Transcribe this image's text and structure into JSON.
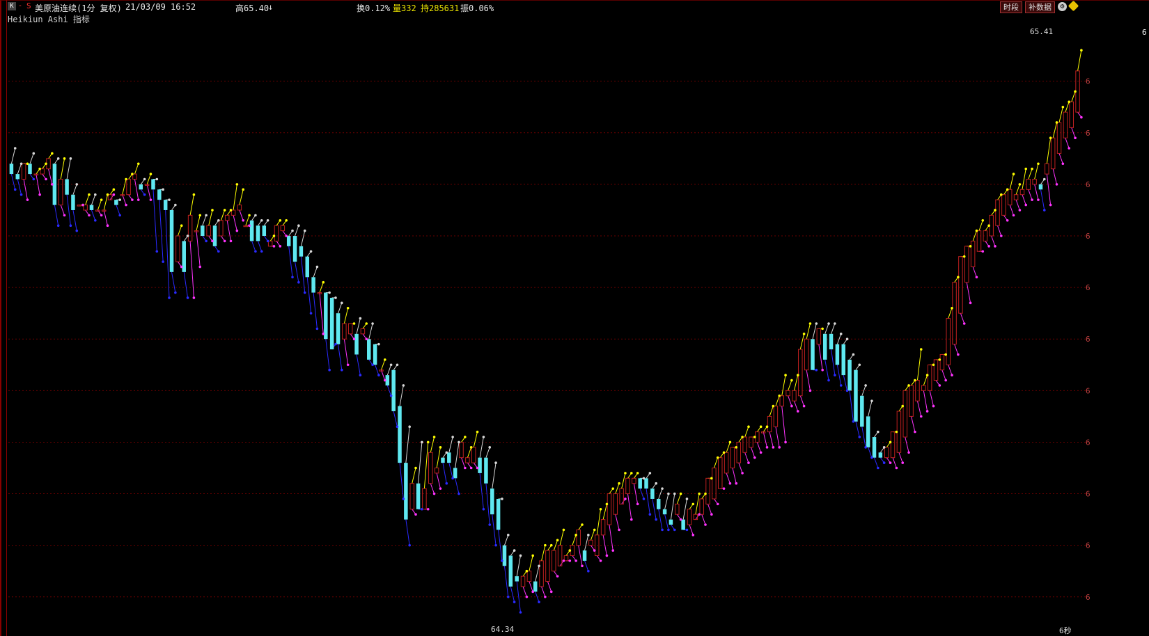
{
  "header": {
    "k_button": "K",
    "s_button": "S",
    "instrument": "美原油连续(1分  复权)",
    "datetime": "21/03/09 16:52",
    "high": "高65.40",
    "high_arrow": "↓",
    "turnover": "换0.12%",
    "volume_label": "量332",
    "hold_label": "持285631",
    "amplitude": "振0.06%",
    "btn_period": "时段",
    "btn_supplement": "补数据",
    "settings_icon": "gear-icon",
    "warn_icon": "diamond-warning-icon"
  },
  "indicator": {
    "name": "Heikiun Ashi 指标"
  },
  "annotations": {
    "max_label": "65.41",
    "min_label": "64.34",
    "timer_label": "6秒",
    "right_tag": "6"
  },
  "colors": {
    "bg": "#000000",
    "up_border": "#c02020",
    "down_fill": "#5fe8f0",
    "grid": "#6a0000",
    "yellow": "#ffff00",
    "magenta": "#ff33ff",
    "blue": "#2a2aff",
    "white": "#d8d8d8"
  },
  "chart_data": {
    "type": "candlestick",
    "ylim": [
      64.32,
      65.44
    ],
    "grid_values": [
      65.35,
      65.25,
      65.15,
      65.05,
      64.95,
      64.85,
      64.75,
      64.65,
      64.55,
      64.45,
      64.35
    ],
    "y_tick_labels": [
      "6",
      "6",
      "6",
      "6",
      "6",
      "6",
      "6",
      "6",
      "6",
      "6",
      "6"
    ],
    "candles": [
      [
        65.19,
        65.17,
        65.22,
        65.14
      ],
      [
        65.17,
        65.16,
        65.19,
        65.13
      ],
      [
        65.16,
        65.19,
        65.19,
        65.12
      ],
      [
        65.19,
        65.17,
        65.21,
        65.16
      ],
      [
        65.17,
        65.17,
        65.18,
        65.13
      ],
      [
        65.17,
        65.18,
        65.19,
        65.16
      ],
      [
        65.18,
        65.2,
        65.21,
        65.15
      ],
      [
        65.19,
        65.11,
        65.2,
        65.07
      ],
      [
        65.11,
        65.16,
        65.2,
        65.09
      ],
      [
        65.16,
        65.13,
        65.2,
        65.07
      ],
      [
        65.13,
        65.1,
        65.15,
        65.06
      ],
      [
        65.11,
        65.11,
        65.11,
        65.11
      ],
      [
        65.1,
        65.11,
        65.13,
        65.09
      ],
      [
        65.11,
        65.1,
        65.13,
        65.08
      ],
      [
        65.1,
        65.1,
        65.12,
        65.09
      ],
      [
        65.1,
        65.1,
        65.13,
        65.07
      ],
      [
        65.12,
        65.13,
        65.14,
        65.13
      ],
      [
        65.12,
        65.11,
        65.12,
        65.09
      ],
      [
        65.13,
        65.13,
        65.16,
        65.11
      ],
      [
        65.13,
        65.16,
        65.17,
        65.12
      ],
      [
        65.16,
        65.17,
        65.19,
        65.12
      ],
      [
        65.15,
        65.14,
        65.16,
        65.13
      ],
      [
        65.15,
        65.15,
        65.17,
        65.12
      ],
      [
        65.16,
        65.14,
        65.16,
        65.02
      ],
      [
        65.14,
        65.12,
        65.14,
        65.0
      ],
      [
        65.12,
        65.1,
        65.12,
        64.93
      ],
      [
        65.1,
        64.98,
        65.11,
        64.94
      ],
      [
        65.0,
        65.05,
        65.07,
        64.99
      ],
      [
        65.04,
        64.98,
        65.05,
        64.93
      ],
      [
        65.04,
        65.09,
        65.13,
        64.93
      ],
      [
        65.06,
        65.06,
        65.09,
        64.99
      ],
      [
        65.07,
        65.05,
        65.09,
        65.04
      ],
      [
        65.05,
        65.07,
        65.1,
        65.04
      ],
      [
        65.07,
        65.03,
        65.08,
        65.02
      ],
      [
        65.05,
        65.08,
        65.1,
        65.04
      ],
      [
        65.08,
        65.09,
        65.1,
        65.04
      ],
      [
        65.09,
        65.1,
        65.15,
        65.06
      ],
      [
        65.1,
        65.11,
        65.14,
        65.08
      ],
      [
        65.07,
        65.07,
        65.09,
        65.07
      ],
      [
        65.08,
        65.04,
        65.09,
        65.02
      ],
      [
        65.07,
        65.04,
        65.08,
        65.02
      ],
      [
        65.07,
        65.05,
        65.08,
        65.04
      ],
      [
        65.03,
        65.04,
        65.05,
        65.03
      ],
      [
        65.04,
        65.07,
        65.08,
        65.03
      ],
      [
        65.06,
        65.07,
        65.08,
        65.05
      ],
      [
        65.05,
        65.03,
        65.06,
        64.97
      ],
      [
        65.05,
        65.0,
        65.07,
        64.96
      ],
      [
        65.03,
        65.01,
        65.06,
        64.94
      ],
      [
        65.01,
        64.97,
        65.02,
        64.9
      ],
      [
        64.97,
        64.94,
        64.99,
        64.87
      ],
      [
        64.94,
        64.94,
        64.96,
        64.86
      ],
      [
        64.94,
        64.85,
        64.94,
        64.79
      ],
      [
        64.93,
        64.83,
        64.93,
        64.84
      ],
      [
        64.9,
        64.84,
        64.92,
        64.79
      ],
      [
        64.85,
        64.88,
        64.91,
        64.8
      ],
      [
        64.86,
        64.88,
        64.88,
        64.85
      ],
      [
        64.86,
        64.82,
        64.89,
        64.78
      ],
      [
        64.86,
        64.87,
        64.88,
        64.85
      ],
      [
        64.85,
        64.81,
        64.88,
        64.8
      ],
      [
        64.84,
        64.8,
        64.84,
        64.78
      ],
      [
        64.79,
        64.79,
        64.81,
        64.77
      ],
      [
        64.78,
        64.76,
        64.8,
        64.74
      ],
      [
        64.79,
        64.71,
        64.8,
        64.68
      ],
      [
        64.72,
        64.61,
        64.76,
        64.54
      ],
      [
        64.61,
        64.5,
        64.68,
        64.45
      ],
      [
        64.52,
        64.57,
        64.6,
        64.51
      ],
      [
        64.57,
        64.52,
        64.65,
        64.52
      ],
      [
        64.52,
        64.56,
        64.65,
        64.52
      ],
      [
        64.57,
        64.63,
        64.66,
        64.55
      ],
      [
        64.59,
        64.6,
        64.64,
        64.56
      ],
      [
        64.62,
        64.61,
        64.63,
        64.57
      ],
      [
        64.63,
        64.61,
        64.66,
        64.58
      ],
      [
        64.6,
        64.58,
        64.65,
        64.55
      ],
      [
        64.62,
        64.65,
        64.66,
        64.6
      ],
      [
        64.61,
        64.62,
        64.64,
        64.6
      ],
      [
        64.61,
        64.64,
        64.67,
        64.6
      ],
      [
        64.62,
        64.59,
        64.66,
        64.52
      ],
      [
        64.62,
        64.57,
        64.64,
        64.49
      ],
      [
        64.56,
        64.51,
        64.61,
        64.45
      ],
      [
        64.54,
        64.48,
        64.54,
        64.42
      ],
      [
        64.45,
        64.41,
        64.47,
        64.35
      ],
      [
        64.43,
        64.37,
        64.44,
        64.34
      ],
      [
        64.39,
        64.38,
        64.43,
        64.32
      ],
      [
        64.37,
        64.39,
        64.4,
        64.35
      ],
      [
        64.38,
        64.4,
        64.43,
        64.36
      ],
      [
        64.38,
        64.36,
        64.41,
        64.34
      ],
      [
        64.37,
        64.42,
        64.45,
        64.35
      ],
      [
        64.38,
        64.44,
        64.45,
        64.36
      ],
      [
        64.4,
        64.44,
        64.46,
        64.39
      ],
      [
        64.41,
        64.45,
        64.48,
        64.42
      ],
      [
        64.42,
        64.43,
        64.44,
        64.42
      ],
      [
        64.43,
        64.45,
        64.47,
        64.42
      ],
      [
        64.45,
        64.48,
        64.49,
        64.41
      ],
      [
        64.44,
        64.42,
        64.47,
        64.4
      ],
      [
        64.45,
        64.46,
        64.48,
        64.44
      ],
      [
        64.43,
        64.47,
        64.52,
        64.42
      ],
      [
        64.47,
        64.5,
        64.53,
        64.43
      ],
      [
        64.49,
        64.55,
        64.56,
        64.44
      ],
      [
        64.51,
        64.55,
        64.57,
        64.48
      ],
      [
        64.53,
        64.56,
        64.59,
        64.54
      ],
      [
        64.55,
        64.58,
        64.59,
        64.5
      ],
      [
        64.57,
        64.58,
        64.59,
        64.53
      ],
      [
        64.58,
        64.56,
        64.58,
        64.54
      ],
      [
        64.58,
        64.56,
        64.59,
        64.51
      ],
      [
        64.56,
        64.54,
        64.57,
        64.5
      ],
      [
        64.54,
        64.52,
        64.56,
        64.48
      ],
      [
        64.52,
        64.51,
        64.55,
        64.48
      ],
      [
        64.5,
        64.49,
        64.55,
        64.48
      ],
      [
        64.51,
        64.53,
        64.55,
        64.5
      ],
      [
        64.5,
        64.48,
        64.54,
        64.48
      ],
      [
        64.49,
        64.52,
        64.53,
        64.47
      ],
      [
        64.5,
        64.51,
        64.55,
        64.51
      ],
      [
        64.51,
        64.54,
        64.55,
        64.49
      ],
      [
        64.53,
        64.58,
        64.58,
        64.51
      ],
      [
        64.54,
        64.6,
        64.62,
        64.53
      ],
      [
        64.56,
        64.62,
        64.63,
        64.56
      ],
      [
        64.59,
        64.63,
        64.65,
        64.57
      ],
      [
        64.6,
        64.64,
        64.64,
        64.57
      ],
      [
        64.61,
        64.65,
        64.66,
        64.59
      ],
      [
        64.63,
        64.66,
        64.68,
        64.61
      ],
      [
        64.64,
        64.66,
        64.66,
        64.62
      ],
      [
        64.65,
        64.67,
        64.68,
        64.63
      ],
      [
        64.67,
        64.67,
        64.68,
        64.64
      ],
      [
        64.67,
        64.7,
        64.72,
        64.64
      ],
      [
        64.68,
        64.72,
        64.74,
        64.64
      ],
      [
        64.72,
        64.74,
        64.78,
        64.65
      ],
      [
        64.74,
        64.75,
        64.77,
        64.72
      ],
      [
        64.73,
        64.75,
        64.78,
        64.71
      ],
      [
        64.74,
        64.83,
        64.86,
        64.72
      ],
      [
        64.79,
        64.85,
        64.88,
        64.75
      ],
      [
        64.85,
        64.79,
        64.88,
        64.79
      ],
      [
        64.84,
        64.87,
        64.87,
        64.79
      ],
      [
        64.86,
        64.81,
        64.88,
        64.77
      ],
      [
        64.86,
        64.83,
        64.88,
        64.78
      ],
      [
        64.84,
        64.8,
        64.86,
        64.76
      ],
      [
        64.84,
        64.78,
        64.85,
        64.75
      ],
      [
        64.81,
        64.75,
        64.82,
        64.69
      ],
      [
        64.79,
        64.69,
        64.8,
        64.66
      ],
      [
        64.74,
        64.68,
        64.76,
        64.64
      ],
      [
        64.7,
        64.64,
        64.73,
        64.62
      ],
      [
        64.66,
        64.62,
        64.67,
        64.6
      ],
      [
        64.63,
        64.62,
        64.64,
        64.61
      ],
      [
        64.62,
        64.64,
        64.65,
        64.61
      ],
      [
        64.62,
        64.67,
        64.67,
        64.6
      ],
      [
        64.63,
        64.71,
        64.72,
        64.61
      ],
      [
        64.66,
        64.75,
        64.76,
        64.63
      ],
      [
        64.7,
        64.76,
        64.77,
        64.67
      ],
      [
        64.73,
        64.77,
        64.83,
        64.7
      ],
      [
        64.75,
        64.76,
        64.78,
        64.71
      ],
      [
        64.75,
        64.8,
        64.8,
        64.72
      ],
      [
        64.77,
        64.81,
        64.81,
        64.76
      ],
      [
        64.79,
        64.82,
        64.82,
        64.77
      ],
      [
        64.8,
        64.89,
        64.91,
        64.78
      ],
      [
        64.84,
        64.96,
        64.97,
        64.82
      ],
      [
        64.9,
        65.01,
        65.01,
        64.88
      ],
      [
        64.96,
        65.03,
        65.03,
        64.92
      ],
      [
        64.99,
        65.04,
        65.06,
        64.97
      ],
      [
        65.02,
        65.06,
        65.08,
        65.02
      ],
      [
        65.04,
        65.06,
        65.07,
        65.03
      ],
      [
        65.05,
        65.09,
        65.1,
        65.03
      ],
      [
        65.07,
        65.12,
        65.13,
        65.05
      ],
      [
        65.09,
        65.13,
        65.14,
        65.08
      ],
      [
        65.11,
        65.14,
        65.17,
        65.09
      ],
      [
        65.12,
        65.13,
        65.15,
        65.1
      ],
      [
        65.13,
        65.14,
        65.18,
        65.11
      ],
      [
        65.14,
        65.16,
        65.18,
        65.12
      ],
      [
        65.15,
        65.16,
        65.19,
        65.12
      ],
      [
        65.15,
        65.14,
        65.16,
        65.1
      ],
      [
        65.17,
        65.19,
        65.24,
        65.11
      ],
      [
        65.18,
        65.24,
        65.27,
        65.15
      ],
      [
        65.21,
        65.27,
        65.3,
        65.19
      ],
      [
        65.24,
        65.29,
        65.31,
        65.22
      ],
      [
        65.26,
        65.31,
        65.33,
        65.24
      ],
      [
        65.29,
        65.37,
        65.41,
        65.28
      ]
    ]
  }
}
